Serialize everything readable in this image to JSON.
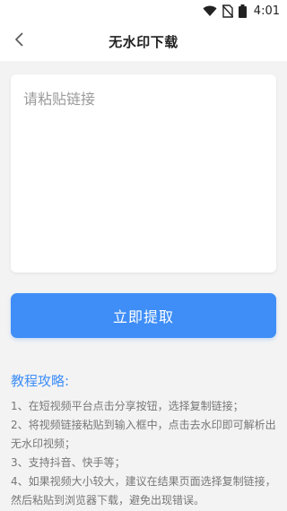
{
  "statusbar": {
    "time": "4:01",
    "icons": [
      "wifi-icon",
      "no-sim-icon",
      "battery-icon"
    ]
  },
  "navbar": {
    "title": "无水印下载",
    "back_icon": "chevron-left-icon"
  },
  "input": {
    "placeholder": "请粘贴链接",
    "value": ""
  },
  "extract_button": {
    "label": "立即提取"
  },
  "guide": {
    "title": "教程攻略:",
    "items": [
      "1、在短视频平台点击分享按钮，选择复制链接；",
      "2、将视频链接粘贴到输入框中，点击去水印即可解析出无水印视频；",
      "3、支持抖音、快手等；",
      "4、如果视频大小较大，建议在结果页面选择复制链接，然后粘贴到浏览器下载，避免出现错误。"
    ]
  },
  "colors": {
    "accent": "#3f8ef7",
    "background": "#f3f3f3",
    "card": "#ffffff",
    "guide_text": "#777777"
  }
}
